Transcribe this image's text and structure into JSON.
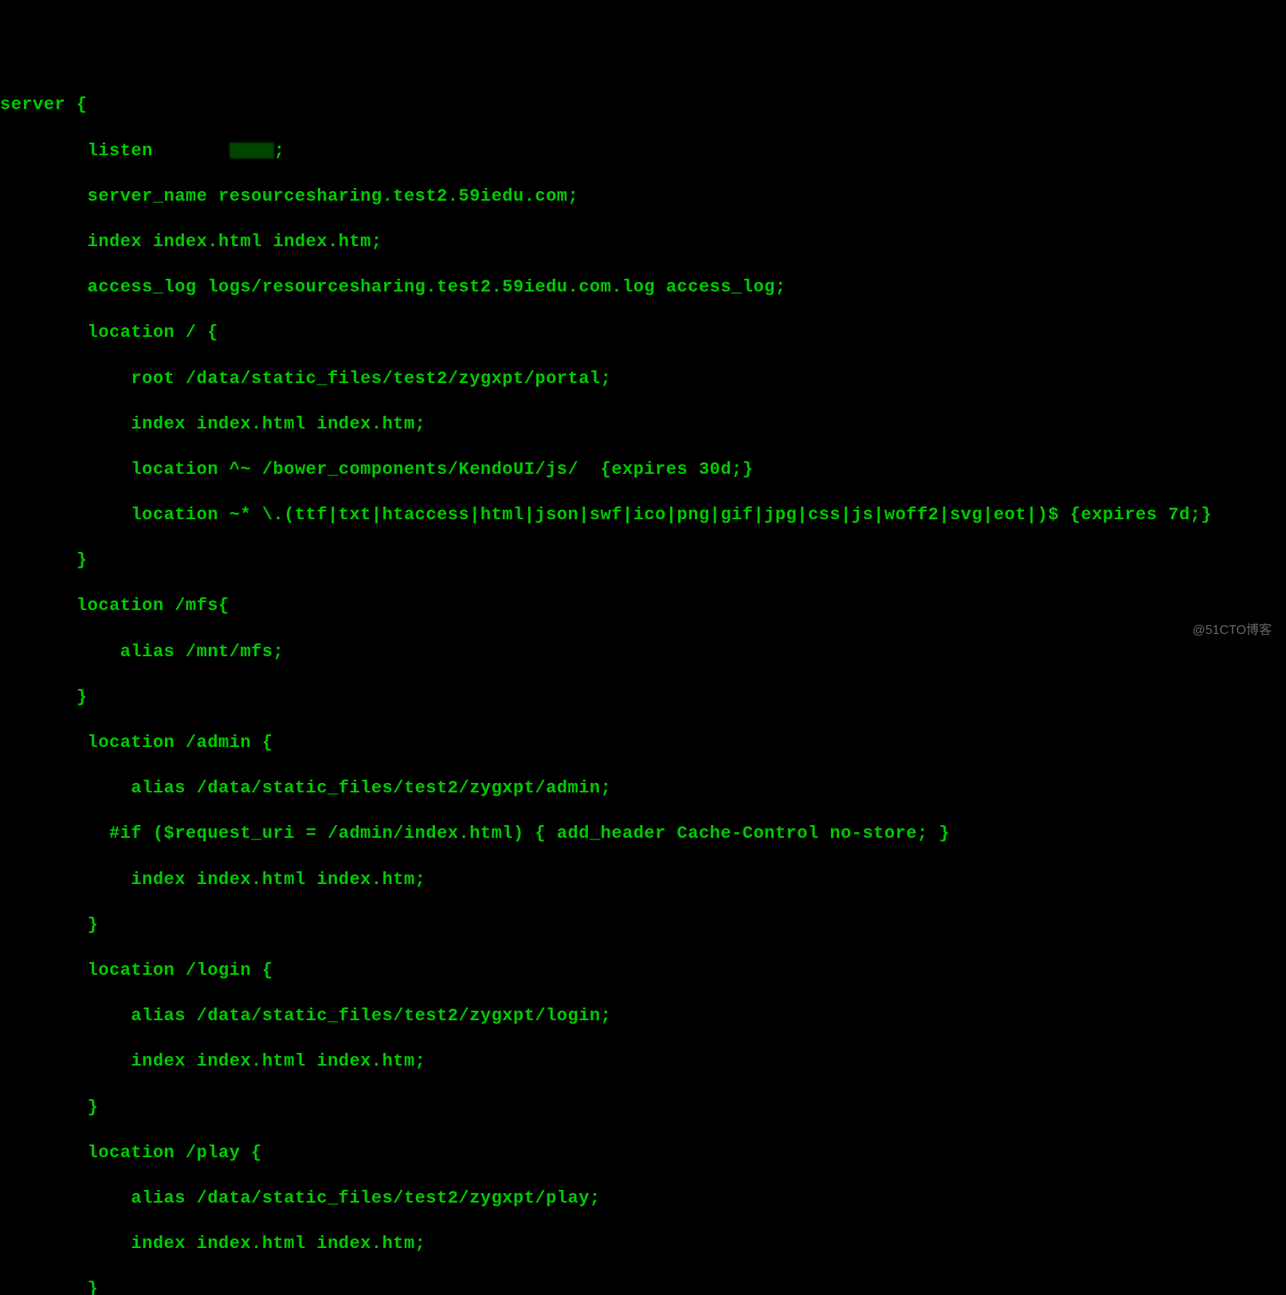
{
  "lines": {
    "l0": "server {",
    "l1_a": "        listen       ",
    "l1_b": ";",
    "l2": "        server_name resourcesharing.test2.59iedu.com;",
    "l3": "        index index.html index.htm;",
    "l4": "        access_log logs/resourcesharing.test2.59iedu.com.log access_log;",
    "l5": "        location / {",
    "l6": "            root /data/static_files/test2/zygxpt/portal;",
    "l7": "            index index.html index.htm;",
    "l8": "            location ^~ /bower_components/KendoUI/js/  {expires 30d;}",
    "l9": "            location ~* \\.(ttf|txt|htaccess|html|json|swf|ico|png|gif|jpg|css|js|woff2|svg|eot|)$ {expires 7d;}",
    "l10": "       }",
    "l11": "       location /mfs{",
    "l12": "           alias /mnt/mfs;",
    "l13": "       }",
    "l14": "        location /admin {",
    "l15": "            alias /data/static_files/test2/zygxpt/admin;",
    "l16": "          #if ($request_uri = /admin/index.html) { add_header Cache-Control no-store; }",
    "l17": "            index index.html index.htm;",
    "l18": "        }",
    "l19": "        location /login {",
    "l20": "            alias /data/static_files/test2/zygxpt/login;",
    "l21": "            index index.html index.htm;",
    "l22": "        }",
    "l23": "        location /play {",
    "l24": "            alias /data/static_files/test2/zygxpt/play;",
    "l25": "            index index.html index.htm;",
    "l26": "        }"
  },
  "watermark": "@51CTO博客"
}
